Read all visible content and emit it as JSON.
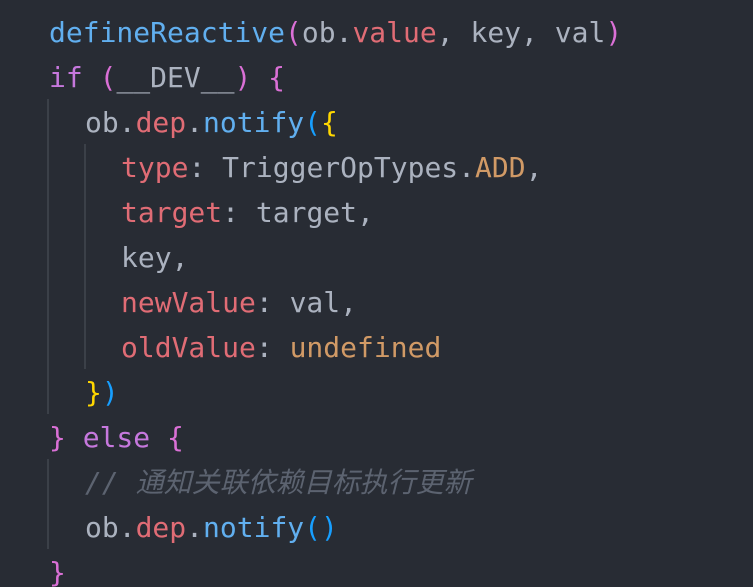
{
  "editor": {
    "background": "#282c34",
    "colors": {
      "plain": "#abb2bf",
      "keyword": "#c678dd",
      "function": "#61afef",
      "property": "#e06c75",
      "constant": "#d19a66",
      "type": "#e5c07b",
      "bracket_yellow": "#ffd700",
      "bracket_pink": "#da70d6",
      "bracket_blue": "#179fff",
      "comment": "#5c6370"
    },
    "lines": [
      {
        "indent": 0,
        "tokens": [
          {
            "text": "defineReactive",
            "kind": "function"
          },
          {
            "text": "(",
            "kind": "bracket_pink"
          },
          {
            "text": "ob.",
            "kind": "plain"
          },
          {
            "text": "value",
            "kind": "property"
          },
          {
            "text": ", key, val",
            "kind": "plain"
          },
          {
            "text": ")",
            "kind": "bracket_pink"
          }
        ]
      },
      {
        "indent": 0,
        "tokens": [
          {
            "text": "if",
            "kind": "keyword"
          },
          {
            "text": " ",
            "kind": "plain"
          },
          {
            "text": "(",
            "kind": "bracket_pink"
          },
          {
            "text": "__DEV__",
            "kind": "plain"
          },
          {
            "text": ")",
            "kind": "bracket_pink"
          },
          {
            "text": " ",
            "kind": "plain"
          },
          {
            "text": "{",
            "kind": "bracket_pink"
          }
        ]
      },
      {
        "indent": 1,
        "tokens": [
          {
            "text": "ob.",
            "kind": "plain"
          },
          {
            "text": "dep",
            "kind": "property"
          },
          {
            "text": ".",
            "kind": "plain"
          },
          {
            "text": "notify",
            "kind": "function"
          },
          {
            "text": "(",
            "kind": "bracket_blue"
          },
          {
            "text": "{",
            "kind": "bracket_yellow"
          }
        ]
      },
      {
        "indent": 2,
        "tokens": [
          {
            "text": "type",
            "kind": "property"
          },
          {
            "text": ": TriggerOpTypes.",
            "kind": "plain"
          },
          {
            "text": "ADD",
            "kind": "constant"
          },
          {
            "text": ",",
            "kind": "plain"
          }
        ]
      },
      {
        "indent": 2,
        "tokens": [
          {
            "text": "target",
            "kind": "property"
          },
          {
            "text": ": target,",
            "kind": "plain"
          }
        ]
      },
      {
        "indent": 2,
        "tokens": [
          {
            "text": "key,",
            "kind": "plain"
          }
        ]
      },
      {
        "indent": 2,
        "tokens": [
          {
            "text": "newValue",
            "kind": "property"
          },
          {
            "text": ": val,",
            "kind": "plain"
          }
        ]
      },
      {
        "indent": 2,
        "tokens": [
          {
            "text": "oldValue",
            "kind": "property"
          },
          {
            "text": ": ",
            "kind": "plain"
          },
          {
            "text": "undefined",
            "kind": "constant"
          }
        ]
      },
      {
        "indent": 1,
        "tokens": [
          {
            "text": "}",
            "kind": "bracket_yellow"
          },
          {
            "text": ")",
            "kind": "bracket_blue"
          }
        ]
      },
      {
        "indent": 0,
        "tokens": [
          {
            "text": "}",
            "kind": "bracket_pink"
          },
          {
            "text": " ",
            "kind": "plain"
          },
          {
            "text": "else",
            "kind": "keyword"
          },
          {
            "text": " ",
            "kind": "plain"
          },
          {
            "text": "{",
            "kind": "bracket_pink"
          }
        ]
      },
      {
        "indent": 1,
        "tokens": [
          {
            "text": "// 通知关联依赖目标执行更新",
            "kind": "comment"
          }
        ]
      },
      {
        "indent": 1,
        "tokens": [
          {
            "text": "ob.",
            "kind": "plain"
          },
          {
            "text": "dep",
            "kind": "property"
          },
          {
            "text": ".",
            "kind": "plain"
          },
          {
            "text": "notify",
            "kind": "function"
          },
          {
            "text": "()",
            "kind": "bracket_blue"
          }
        ]
      },
      {
        "indent": 0,
        "tokens": [
          {
            "text": "}",
            "kind": "bracket_pink"
          }
        ]
      }
    ]
  }
}
